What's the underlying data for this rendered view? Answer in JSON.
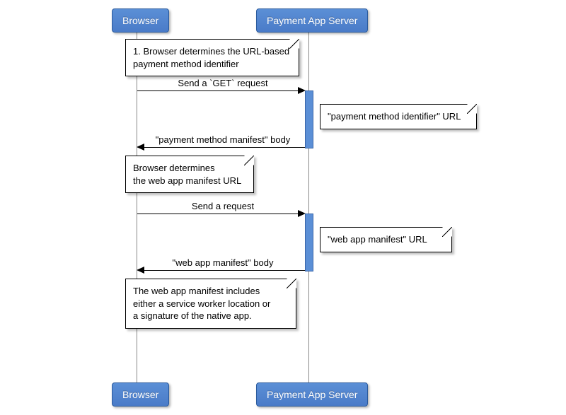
{
  "participants": {
    "browser": "Browser",
    "server": "Payment App Server"
  },
  "notes": {
    "n1": "1. Browser determines the URL-based\npayment method identifier",
    "n2": "\"payment method identifier\" URL",
    "n3": "Browser determines\nthe web app manifest URL",
    "n4": "\"web app manifest\" URL",
    "n5": "The web app manifest includes\neither a service worker location or\na signature of the native app."
  },
  "messages": {
    "m1": "Send a `GET` request",
    "m2": "\"payment method manifest\" body",
    "m3": "Send a request",
    "m4": "\"web app manifest\" body"
  },
  "chart_data": {
    "type": "sequence-diagram",
    "participants": [
      "Browser",
      "Payment App Server"
    ],
    "steps": [
      {
        "kind": "note",
        "on": "Browser",
        "text": "1. Browser determines the URL-based payment method identifier"
      },
      {
        "kind": "message",
        "from": "Browser",
        "to": "Payment App Server",
        "label": "Send a `GET` request"
      },
      {
        "kind": "note",
        "on": "Payment App Server",
        "side": "right",
        "text": "\"payment method identifier\" URL"
      },
      {
        "kind": "message",
        "from": "Payment App Server",
        "to": "Browser",
        "label": "\"payment method manifest\" body"
      },
      {
        "kind": "note",
        "on": "Browser",
        "text": "Browser determines the web app manifest URL"
      },
      {
        "kind": "message",
        "from": "Browser",
        "to": "Payment App Server",
        "label": "Send a request"
      },
      {
        "kind": "note",
        "on": "Payment App Server",
        "side": "right",
        "text": "\"web app manifest\" URL"
      },
      {
        "kind": "message",
        "from": "Payment App Server",
        "to": "Browser",
        "label": "\"web app manifest\" body"
      },
      {
        "kind": "note",
        "on": "Browser",
        "text": "The web app manifest includes either a service worker location or a signature of the native app."
      }
    ]
  }
}
